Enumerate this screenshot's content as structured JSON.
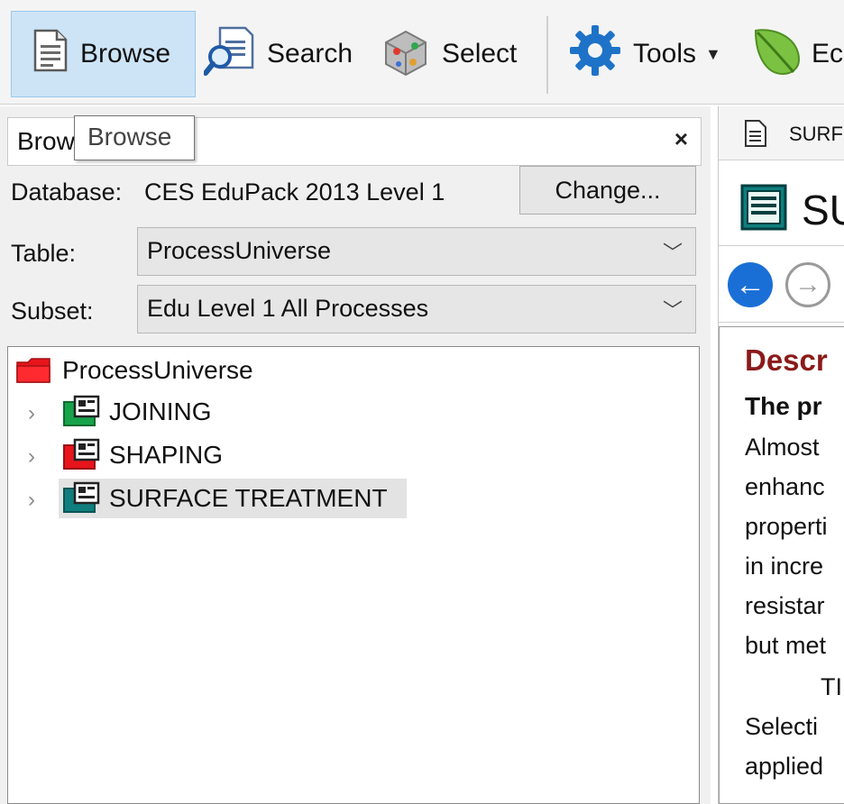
{
  "toolbar": {
    "browse_label": "Browse",
    "search_label": "Search",
    "select_label": "Select",
    "tools_label": "Tools",
    "eco_label": "Ec",
    "active": "browse",
    "active_color": "#cde4f7"
  },
  "browse_panel": {
    "title": "Brow",
    "close_glyph": "×",
    "tooltip": "Browse",
    "database_label": "Database:",
    "database_value": "CES EduPack 2013 Level 1",
    "change_button": "Change...",
    "table_label": "Table:",
    "table_value": "ProcessUniverse",
    "subset_label": "Subset:",
    "subset_value": "Edu Level 1 All Processes"
  },
  "tree": {
    "root": {
      "label": "ProcessUniverse",
      "icon": "folder-icon",
      "color": "#e8141b"
    },
    "items": [
      {
        "label": "JOINING",
        "icon": "record-icon",
        "color": "#17a34a",
        "expand": "›"
      },
      {
        "label": "SHAPING",
        "icon": "record-icon",
        "color": "#e8141b",
        "expand": "›"
      },
      {
        "label": "SURFACE TREATMENT",
        "icon": "record-icon",
        "color": "#0f7e7e",
        "expand": "›",
        "selected": true
      }
    ]
  },
  "report": {
    "tab_label": "SURF",
    "title": "SU",
    "back_glyph": "←",
    "forward_glyph": "→",
    "heading": "Descr",
    "subheading": "The pr",
    "lines": [
      "Almost",
      "enhanc",
      "properti",
      "in incre",
      "resistar",
      "but met",
      "TI",
      "Selecti",
      "applied"
    ]
  }
}
